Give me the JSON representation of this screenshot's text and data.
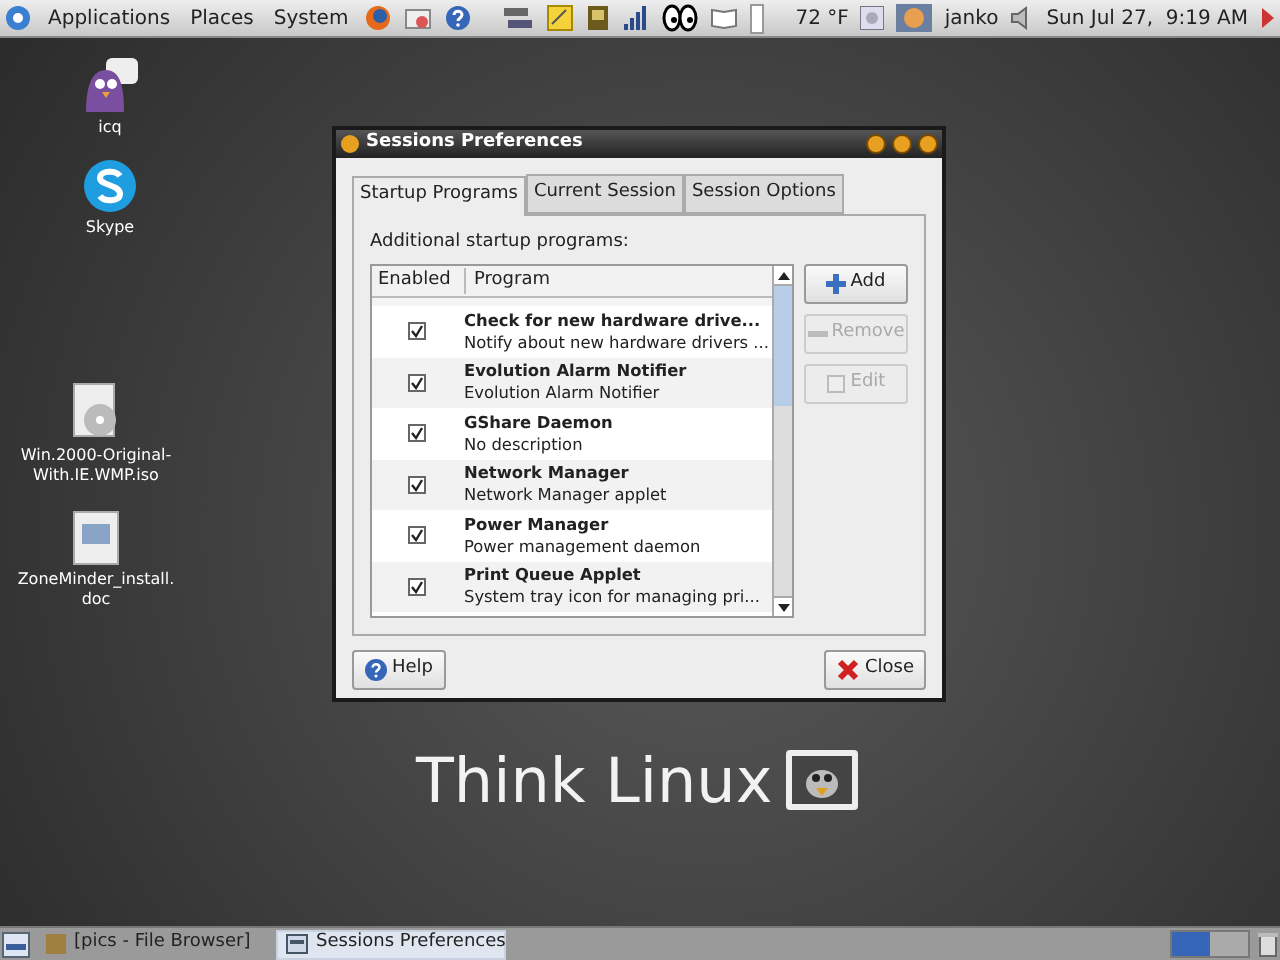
{
  "top_panel": {
    "menus": [
      "Applications",
      "Places",
      "System"
    ],
    "weather": "72 °F",
    "user": "janko",
    "clock": "Sun Jul 27,  9:19 AM"
  },
  "desktop_icons": [
    {
      "kind": "icq",
      "label": "icq"
    },
    {
      "kind": "skype",
      "label": "Skype"
    },
    {
      "kind": "disc",
      "label": "Win.2000-Original-With.IE.WMP.iso"
    },
    {
      "kind": "doc",
      "label": "ZoneMinder_install.doc"
    }
  ],
  "wallpaper_text": "Think Linux",
  "window": {
    "title": "Sessions Preferences",
    "tabs": [
      {
        "label": "Startup Programs",
        "selected": true
      },
      {
        "label": "Current Session",
        "selected": false
      },
      {
        "label": "Session Options",
        "selected": false
      }
    ],
    "list_label": "Additional startup programs:",
    "columns": [
      "Enabled",
      "Program"
    ],
    "rows": [
      {
        "name": "Check for new hardware drive...",
        "description": "Notify about new hardware drivers ...",
        "checked": true
      },
      {
        "name": "Evolution Alarm Notifier",
        "description": "Evolution Alarm Notifier",
        "checked": true
      },
      {
        "name": "GShare Daemon",
        "description": "No description",
        "checked": true
      },
      {
        "name": "Network Manager",
        "description": "Network Manager applet",
        "checked": true
      },
      {
        "name": "Power Manager",
        "description": "Power management daemon",
        "checked": true
      },
      {
        "name": "Print Queue Applet",
        "description": "System tray icon for managing pri...",
        "checked": true
      }
    ],
    "side_buttons": [
      {
        "kind": "add",
        "label": "Add",
        "disabled": false
      },
      {
        "kind": "remove",
        "label": "Remove",
        "disabled": true
      },
      {
        "kind": "edit",
        "label": "Edit",
        "disabled": true
      }
    ],
    "help_button": "Help",
    "close_button": "Close"
  },
  "taskbar": [
    {
      "label": "[pics - File Browser]",
      "selected": false
    },
    {
      "label": "Sessions Preferences",
      "selected": true
    }
  ]
}
